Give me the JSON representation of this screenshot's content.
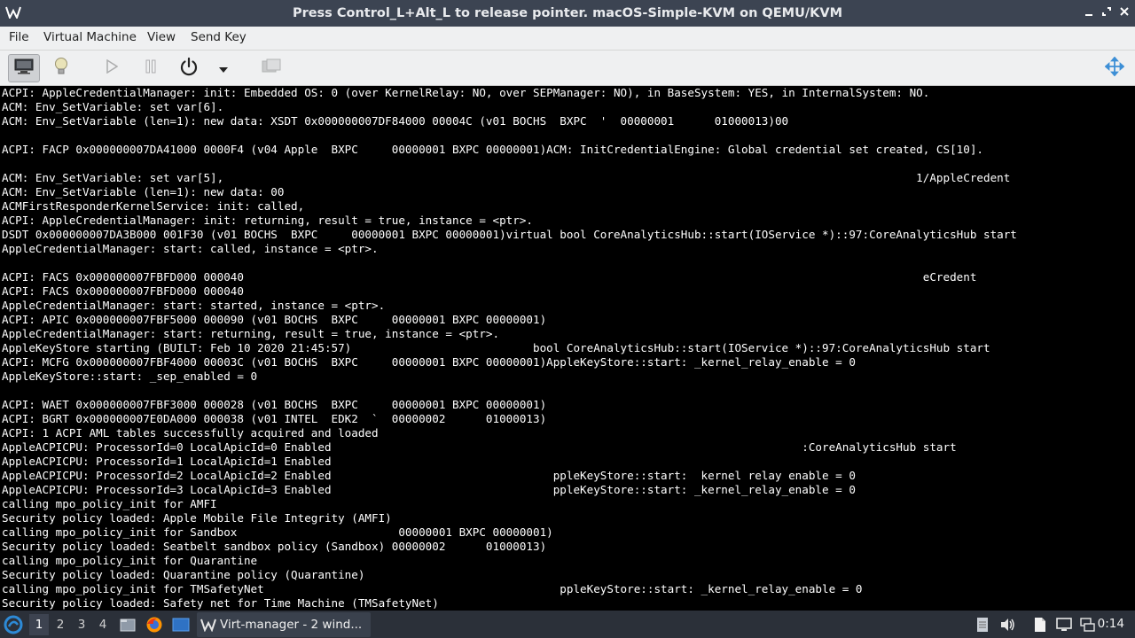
{
  "window": {
    "title": "Press Control_L+Alt_L to release pointer. macOS-Simple-KVM on QEMU/KVM",
    "controls": [
      "minimize-icon",
      "restore-icon",
      "close-icon"
    ]
  },
  "menubar": {
    "items": [
      "File",
      "Virtual Machine",
      "View",
      "Send Key"
    ]
  },
  "toolbar": {
    "buttons": [
      "console-icon",
      "lightbulb-icon",
      "play-icon",
      "pause-icon",
      "power-icon",
      "dropdown-icon",
      "screenshot-icon",
      "fullscreen-icon"
    ]
  },
  "console": {
    "lines": [
      "ACPI: AppleCredentialManager: init: Embedded OS: 0 (over KernelRelay: NO, over SEPManager: NO), in BaseSystem: YES, in InternalSystem: NO.",
      "ACM: Env_SetVariable: set var[6].",
      "ACM: Env_SetVariable (len=1): new data: XSDT 0x000000007DF84000 00004C (v01 BOCHS  BXPC  '  00000001      01000013)00",
      "",
      "ACPI: FACP 0x000000007DA41000 0000F4 (v04 Apple  BXPC     00000001 BXPC 00000001)ACM: InitCredentialEngine: Global credential set created, CS[10].",
      "",
      "ACM: Env_SetVariable: set var[5],                                                                                                       1/AppleCredent",
      "ACM: Env_SetVariable (len=1): new data: 00",
      "ACMFirstResponderKernelService: init: called,",
      "ACPI: AppleCredentialManager: init: returning, result = true, instance = <ptr>.",
      "DSDT 0x000000007DA3B000 001F30 (v01 BOCHS  BXPC     00000001 BXPC 00000001)virtual bool CoreAnalyticsHub::start(IOService *)::97:CoreAnalyticsHub start",
      "AppleCredentialManager: start: called, instance = <ptr>.",
      "",
      "ACPI: FACS 0x000000007FBFD000 000040                                                                                                     eCredent",
      "ACPI: FACS 0x000000007FBFD000 000040",
      "AppleCredentialManager: start: started, instance = <ptr>.",
      "ACPI: APIC 0x000000007FBF5000 000090 (v01 BOCHS  BXPC     00000001 BXPC 00000001)",
      "AppleCredentialManager: start: returning, result = true, instance = <ptr>.",
      "AppleKeyStore starting (BUILT: Feb 10 2020 21:45:57)                           bool CoreAnalyticsHub::start(IOService *)::97:CoreAnalyticsHub start",
      "ACPI: MCFG 0x000000007FBF4000 00003C (v01 BOCHS  BXPC     00000001 BXPC 00000001)AppleKeyStore::start: _kernel_relay_enable = 0",
      "AppleKeyStore::start: _sep_enabled = 0",
      "",
      "ACPI: WAET 0x000000007FBF3000 000028 (v01 BOCHS  BXPC     00000001 BXPC 00000001)",
      "ACPI: BGRT 0x000000007E0DA000 000038 (v01 INTEL  EDK2  `  00000002      01000013)",
      "ACPI: 1 ACPI AML tables successfully acquired and loaded",
      "AppleACPICPU: ProcessorId=0 LocalApicId=0 Enabled                                                                      :CoreAnalyticsHub start",
      "AppleACPICPU: ProcessorId=1 LocalApicId=1 Enabled",
      "AppleACPICPU: ProcessorId=2 LocalApicId=2 Enabled                                 ppleKeyStore::start:  kernel relay enable = 0",
      "AppleACPICPU: ProcessorId=3 LocalApicId=3 Enabled                                 ppleKeyStore::start: _kernel_relay_enable = 0",
      "calling mpo_policy_init for AMFI",
      "Security policy loaded: Apple Mobile File Integrity (AMFI)",
      "calling mpo_policy_init for Sandbox                        00000001 BXPC 00000001)",
      "Security policy loaded: Seatbelt sandbox policy (Sandbox) 00000002      01000013)",
      "calling mpo_policy_init for Quarantine",
      "Security policy loaded: Quarantine policy (Quarantine)",
      "calling mpo_policy_init for TMSafetyNet                                            ppleKeyStore::start: _kernel_relay_enable = 0",
      "Security policy loaded: Safety net for Time Machine (TMSafetyNet)"
    ]
  },
  "taskbar": {
    "workspaces": [
      "1",
      "2",
      "3",
      "4"
    ],
    "active_workspace": "1",
    "quick_launch": [
      "file-manager-icon",
      "firefox-icon",
      "show-desktop-icon"
    ],
    "task_label": "Virt-manager - 2 wind...",
    "tray": [
      "notes-icon",
      "volume-icon",
      "files-icon",
      "display-icon",
      "network-icon"
    ],
    "clock": "0:14"
  },
  "colors": {
    "titlebar": "#3c4452",
    "menubar": "#eff0f1",
    "console_bg": "#000000",
    "console_text": "#ffffff",
    "taskbar": "#2b3039",
    "start_blue": "#2d8ad6"
  }
}
